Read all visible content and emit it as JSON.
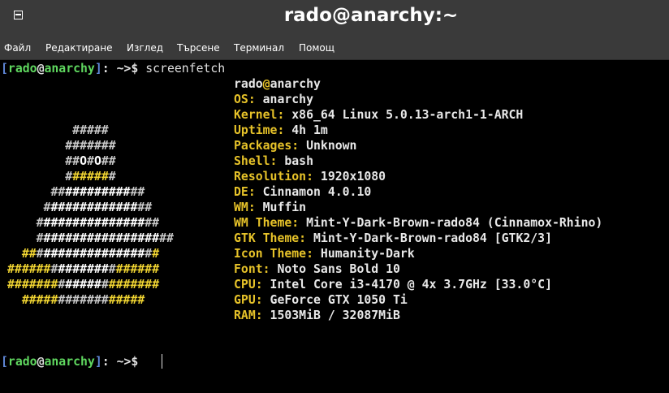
{
  "window": {
    "title": "rado@anarchy:~",
    "menu_icon": "window-menu-icon"
  },
  "menu": [
    "Файл",
    "Редактиране",
    "Изглед",
    "Търсене",
    "Терминал",
    "Помощ"
  ],
  "prompt": {
    "open": "[",
    "user": "rado",
    "at": "@",
    "host": "anarchy",
    "close": "]",
    "path": ": ~>$ "
  },
  "command": "screenfetch",
  "userhost": {
    "user": "rado",
    "at": "@",
    "host": "anarchy"
  },
  "info": [
    {
      "label": "OS:",
      "value": " anarchy"
    },
    {
      "label": "Kernel:",
      "value": " x86_64 Linux 5.0.13-arch1-1-ARCH"
    },
    {
      "label": "Uptime:",
      "value": " 4h 1m"
    },
    {
      "label": "Packages:",
      "value": " Unknown"
    },
    {
      "label": "Shell:",
      "value": " bash"
    },
    {
      "label": "Resolution:",
      "value": " 1920x1080"
    },
    {
      "label": "DE:",
      "value": " Cinnamon 4.0.10"
    },
    {
      "label": "WM:",
      "value": " Muffin"
    },
    {
      "label": "WM Theme:",
      "value": " Mint-Y-Dark-Brown-rado84 (Cinnamox-Rhino)"
    },
    {
      "label": "GTK Theme:",
      "value": " Mint-Y-Dark-Brown-rado84 [GTK2/3]"
    },
    {
      "label": "Icon Theme:",
      "value": " Humanity-Dark"
    },
    {
      "label": "Font:",
      "value": " Noto Sans Bold 10"
    },
    {
      "label": "CPU:",
      "value": " Intel Core i3-4170 @ 4x 3.7GHz [33.0°C]"
    },
    {
      "label": "GPU:",
      "value": " GeForce GTX 1050 Ti"
    },
    {
      "label": "RAM:",
      "value": " 1503MiB / 32087MiB"
    }
  ],
  "logo": [
    [
      [
        "b",
        "         #####"
      ]
    ],
    [
      [
        "b",
        "        #######"
      ]
    ],
    [
      [
        "b",
        "        ##"
      ],
      [
        "w",
        "O"
      ],
      [
        "b",
        "#"
      ],
      [
        "w",
        "O"
      ],
      [
        "b",
        "##"
      ]
    ],
    [
      [
        "b",
        "        #"
      ],
      [
        "y",
        "#####"
      ],
      [
        "b",
        "#"
      ]
    ],
    [
      [
        "b",
        "      ##"
      ],
      [
        "w",
        "#########"
      ],
      [
        "b",
        "##"
      ]
    ],
    [
      [
        "b",
        "     #"
      ],
      [
        "w",
        "############"
      ],
      [
        "b",
        "##"
      ]
    ],
    [
      [
        "b",
        "    #"
      ],
      [
        "w",
        "##############"
      ],
      [
        "b",
        "##"
      ]
    ],
    [
      [
        "b",
        "    #"
      ],
      [
        "w",
        "################"
      ],
      [
        "b",
        "##"
      ]
    ],
    [
      [
        "y",
        "  ##"
      ],
      [
        "b",
        "#"
      ],
      [
        "w",
        "##############"
      ],
      [
        "b",
        "#"
      ],
      [
        "y",
        "#"
      ]
    ],
    [
      [
        "y",
        "######"
      ],
      [
        "b",
        "#"
      ],
      [
        "w",
        "#######"
      ],
      [
        "b",
        "#"
      ],
      [
        "y",
        "######"
      ]
    ],
    [
      [
        "y",
        "#######"
      ],
      [
        "b",
        "#"
      ],
      [
        "w",
        "#####"
      ],
      [
        "b",
        "#"
      ],
      [
        "y",
        "#######"
      ]
    ],
    [
      [
        "y",
        "  #####"
      ],
      [
        "b",
        "#######"
      ],
      [
        "y",
        "#####"
      ]
    ]
  ]
}
